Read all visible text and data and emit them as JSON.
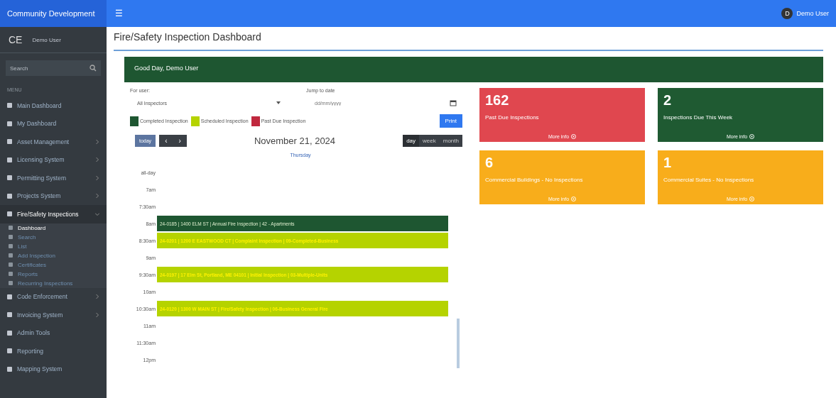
{
  "topbar": {
    "brand": "Community Development",
    "menu_glyph": "☰",
    "user": {
      "initial": "D",
      "name": "Demo User"
    }
  },
  "sidebar": {
    "logo": "CE",
    "user": "Demo User",
    "search": {
      "placeholder": "Search"
    },
    "header": "MENU",
    "items": [
      {
        "label": "Main Dashboard",
        "expandable": false,
        "expanded": false,
        "selected": false
      },
      {
        "label": "My Dashboard",
        "expandable": false,
        "expanded": false,
        "selected": false
      },
      {
        "label": "Asset Management",
        "expandable": true,
        "expanded": false,
        "selected": false
      },
      {
        "label": "Licensing System",
        "expandable": true,
        "expanded": false,
        "selected": false
      },
      {
        "label": "Permitting System",
        "expandable": true,
        "expanded": false,
        "selected": false
      },
      {
        "label": "Projects System",
        "expandable": true,
        "expanded": false,
        "selected": false
      },
      {
        "label": "Fire/Safety Inspections",
        "expandable": true,
        "expanded": true,
        "selected": false,
        "children": [
          {
            "label": "Dashboard",
            "selected": true
          },
          {
            "label": "Search",
            "selected": false
          },
          {
            "label": "List",
            "selected": false
          },
          {
            "label": "Add Inspection",
            "selected": false
          },
          {
            "label": "Certificates",
            "selected": false
          },
          {
            "label": "Reports",
            "selected": false
          },
          {
            "label": "Recurring Inspections",
            "selected": false
          }
        ]
      },
      {
        "label": "Code Enforcement",
        "expandable": true,
        "expanded": false,
        "selected": false
      },
      {
        "label": "Invoicing System",
        "expandable": true,
        "expanded": false,
        "selected": false
      },
      {
        "label": "Admin Tools",
        "expandable": false,
        "expanded": false,
        "selected": false
      },
      {
        "label": "Reporting",
        "expandable": false,
        "expanded": false,
        "selected": false
      },
      {
        "label": "Mapping System",
        "expandable": false,
        "expanded": false,
        "selected": false
      }
    ]
  },
  "page": {
    "title": "Fire/Safety Inspection Dashboard",
    "greeting": "Good Day, Demo User"
  },
  "filters": {
    "user_label": "For user:",
    "user_value": "All Inspectors",
    "date_label": "Jump to date",
    "date_placeholder": "dd/mm/yyyy"
  },
  "legend": [
    {
      "label": "Completed Inspection",
      "color": "#1e5631"
    },
    {
      "label": "Scheduled Inspection",
      "color": "#b5d300"
    },
    {
      "label": "Past Due Inspection",
      "color": "#c0283e"
    }
  ],
  "print_button": "Print",
  "calendar": {
    "today": "today",
    "prev": "‹",
    "next": "›",
    "date": "November 21, 2024",
    "views": [
      {
        "label": "day",
        "selected": true
      },
      {
        "label": "week",
        "selected": false
      },
      {
        "label": "month",
        "selected": false
      }
    ],
    "day_header": "Thursday",
    "slots": [
      {
        "time": "all-day"
      },
      {
        "time": "7am"
      },
      {
        "time": "7:30am"
      },
      {
        "time": "8am",
        "events": [
          {
            "text": "24-0185 | 1400 ELM ST | Annual Fire Inspection | 42 - Apartments",
            "kind": "completed"
          }
        ]
      },
      {
        "time": "8:30am",
        "events": [
          {
            "text": "24-0201 | 1200 E EASTWOOD CT | Complaint Inspection | 09-Completed-Business",
            "kind": "scheduled"
          }
        ]
      },
      {
        "time": "9am"
      },
      {
        "time": "9:30am",
        "events": [
          {
            "text": "24-0197 | 17 Elm St, Portland, ME 04101 | Initial Inspection | 03-Multiple-Units",
            "kind": "scheduled"
          }
        ]
      },
      {
        "time": "10am"
      },
      {
        "time": "10:30am",
        "events": [
          {
            "text": "24-0120 | 1300 W MAIN ST | Fire/Safety Inspection | 06-Business General Fire",
            "kind": "scheduled"
          }
        ]
      },
      {
        "time": "11am"
      },
      {
        "time": "11:30am"
      },
      {
        "time": "12pm"
      }
    ]
  },
  "stats": [
    {
      "value": "162",
      "label": "Past Due Inspections",
      "link": "More info",
      "kind": "danger"
    },
    {
      "value": "2",
      "label": "Inspections Due This Week",
      "link": "More info",
      "kind": "success"
    },
    {
      "value": "6",
      "label": "Commercial Buildings - No Inspections",
      "link": "More info",
      "kind": "warning"
    },
    {
      "value": "1",
      "label": "Commercial Suites - No Inspections",
      "link": "More info",
      "kind": "warning"
    }
  ]
}
